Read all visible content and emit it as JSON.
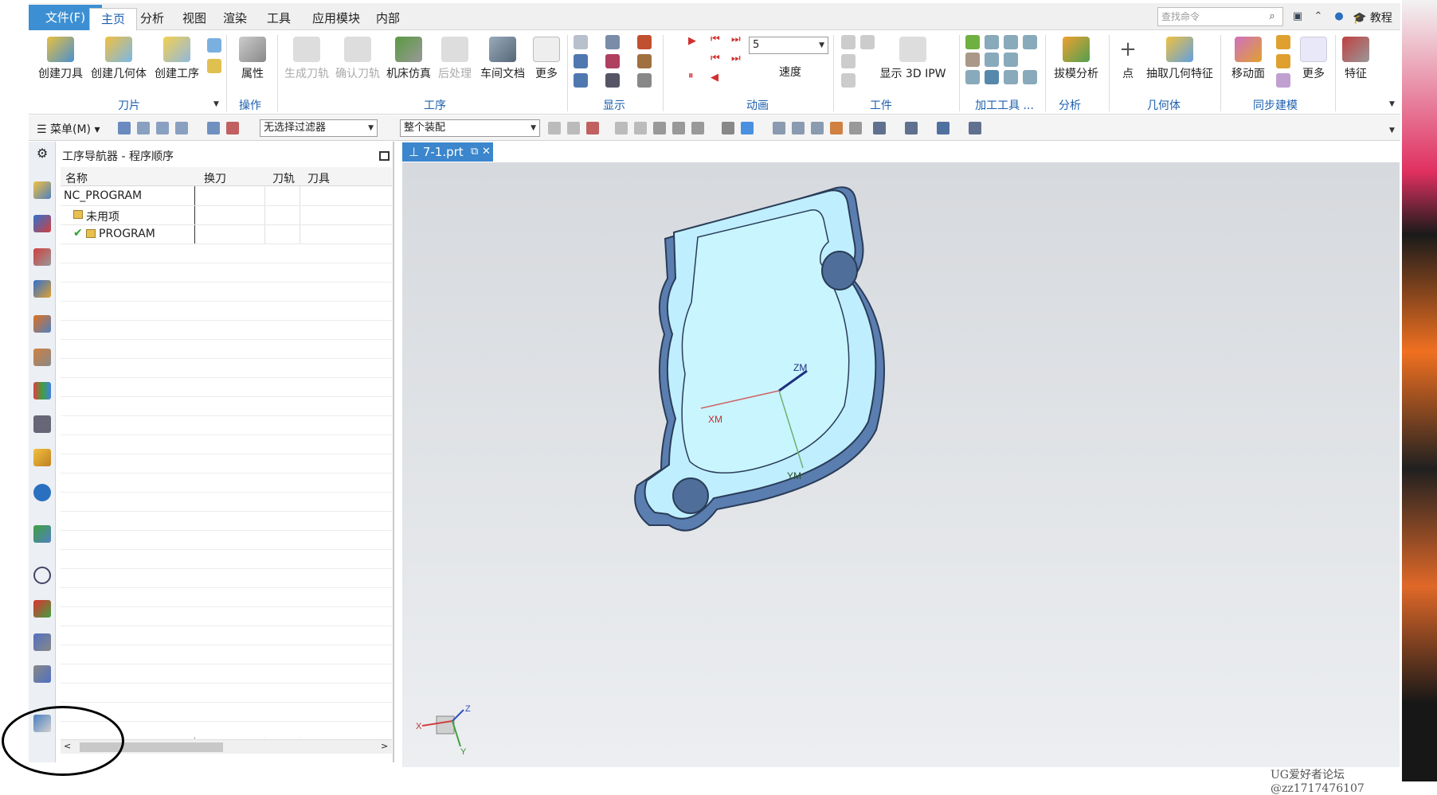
{
  "menubar": {
    "file": "文件(F)",
    "tabs": [
      "主页",
      "分析",
      "视图",
      "渲染",
      "工具",
      "应用模块",
      "内部"
    ],
    "search_placeholder": "查找命令",
    "tutorial": "教程"
  },
  "ribbon": {
    "tools": {
      "create_tool": "创建刀具",
      "create_geometry": "创建几何体",
      "create_operation": "创建工序",
      "group": "刀片"
    },
    "ops": {
      "properties": "属性",
      "group": "操作"
    },
    "operation": {
      "generate_path": "生成刀轨",
      "verify_path": "确认刀轨",
      "machine_sim": "机床仿真",
      "postprocess": "后处理",
      "shop_doc": "车间文档",
      "more": "更多",
      "group": "工序"
    },
    "display": {
      "group": "显示"
    },
    "animation": {
      "speed_value": "5",
      "speed": "速度",
      "group": "动画"
    },
    "workpiece": {
      "show_ipw": "显示 3D IPW",
      "group": "工件"
    },
    "machining": {
      "group": "加工工具 ..."
    },
    "analysis": {
      "draft": "拔模分析",
      "group": "分析"
    },
    "geometry": {
      "point": "点",
      "extract": "抽取几何特征",
      "group": "几何体"
    },
    "sync": {
      "move_face": "移动面",
      "more": "更多",
      "group": "同步建模"
    },
    "feature": {
      "label": "特征"
    }
  },
  "toolbar": {
    "menu": "菜单(M)",
    "filter": "无选择过滤器",
    "assembly": "整个装配"
  },
  "navigator": {
    "title": "工序导航器 - 程序顺序",
    "columns": [
      "名称",
      "换刀",
      "刀轨",
      "刀具"
    ],
    "rows": [
      "NC_PROGRAM",
      "未用项",
      "PROGRAM"
    ]
  },
  "viewport": {
    "tab": "7-1.prt",
    "axes": {
      "zm": "ZM",
      "xm": "XM",
      "ym": "YM"
    },
    "triad": {
      "x": "X",
      "y": "Y",
      "z": "Z"
    }
  },
  "watermark": "UG爱好者论坛@zz1717476107"
}
